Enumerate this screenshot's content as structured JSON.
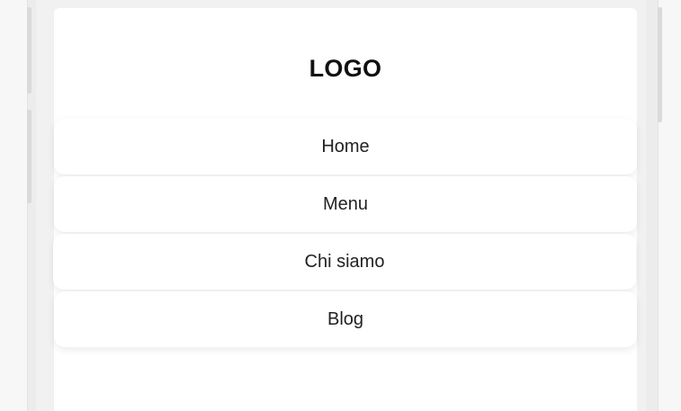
{
  "header": {
    "logo_text": "LOGO"
  },
  "nav": {
    "items": [
      {
        "label": "Home"
      },
      {
        "label": "Menu"
      },
      {
        "label": "Chi siamo"
      },
      {
        "label": "Blog"
      }
    ]
  }
}
